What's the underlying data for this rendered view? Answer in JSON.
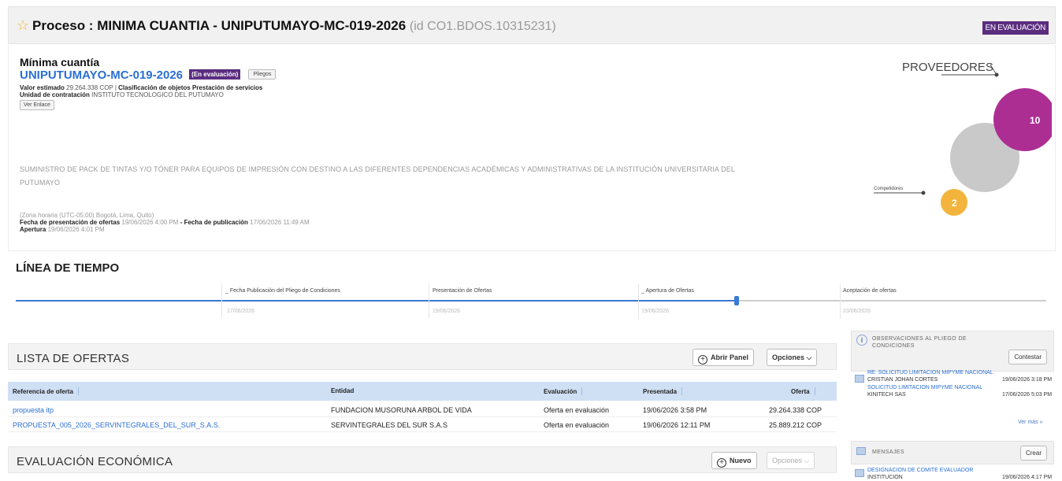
{
  "header": {
    "title": "Proceso : MINIMA CUANTIA  - UNIPUTUMAYO-MC-019-2026",
    "process_id": "(id CO1.BDOS.10315231)",
    "status_badge": "EN EVALUACIÓN"
  },
  "summary": {
    "modality": "Mínima cuantía",
    "code": "UNIPUTUMAYO-MC-019-2026",
    "status_tag": "(En evaluación)",
    "pliegos_button": "Pliegos",
    "valor_label": "Valor estimado",
    "valor_value": "29.264.338 COP",
    "sep": "|",
    "clasificacion_label": "Clasificación de objetos",
    "clasificacion_value": "Prestación de servicios",
    "unidad_label": "Unidad de contratación",
    "unidad_value": "INSTITUTO TECNOLOGICO DEL PUTUMAYO",
    "ver_enlace": "Ver Enlace",
    "description": "SUMINISTRO DE PACK DE TINTAS Y/O TÓNER PARA EQUIPOS DE IMPRESIÓN CON DESTINO A LAS DIFERENTES DEPENDENCIAS ACADÉMICAS Y ADMINISTRATIVAS DE LA INSTITUCIÓN UNIVERSITARIA DEL PUTUMAYO",
    "timezone": "(Zona horaria (UTC-05:00) Bogotá, Lima, Quito)",
    "fecha_presentacion_label": "Fecha de presentación de ofertas",
    "fecha_presentacion_value": "19/06/2026 4:00 PM",
    "dash": "-",
    "fecha_publicacion_label": "Fecha de publicación",
    "fecha_publicacion_value": "17/06/2026 11:49 AM",
    "apertura_label": "Apertura",
    "apertura_value": "19/06/2026 4:01 PM"
  },
  "providers": {
    "title": "PROVEEDORES",
    "big_count": "10",
    "competitors_label": "Competidores",
    "small_count": "2"
  },
  "timeline": {
    "title": "LÍNEA DE TIEMPO",
    "progress": 0.7,
    "stages": [
      {
        "label": "Fecha Publicación del Pliego de Condiciones",
        "date": "17/06/2026"
      },
      {
        "label": "Presentación de Ofertas",
        "date": "19/06/2026"
      },
      {
        "label": "Apertura de Ofertas",
        "date": "19/06/2026"
      },
      {
        "label": "Aceptación de ofertas",
        "date": "23/06/2026"
      }
    ]
  },
  "offers": {
    "title": "LISTA DE OFERTAS",
    "open_panel": "Abrir Panel",
    "options": "Opciones",
    "columns": [
      "Referencia de oferta",
      "Entidad",
      "Evaluación",
      "Presentada",
      "Oferta"
    ],
    "rows": [
      [
        "propuesta itp",
        "FUNDACION MUSORUNA ARBOL DE VIDA",
        "Oferta en evaluación",
        "19/06/2026 3:58 PM",
        "29.264.338 COP"
      ],
      [
        "PROPUESTA_005_2026_SERVINTEGRALES_DEL_SUR_S.A.S.",
        "SERVINTEGRALES DEL SUR S.A.S",
        "Oferta en evaluación",
        "19/06/2026 12:11 PM",
        "25.889.212 COP"
      ]
    ]
  },
  "economic": {
    "title": "EVALUACIÓN ECONÓMICA",
    "new_button": "Nuevo",
    "options": "Opciones"
  },
  "observations": {
    "title_line1": "OBSERVACIONES AL PLIEGO DE",
    "title_line2": "CONDICIONES",
    "reply_button": "Contestar",
    "items": [
      {
        "subject": "RE: SOLICITUD LIMITACION MIPYME NACIONAL",
        "author": "CRISTIAN JOHAN CORTES",
        "date": "19/06/2026 3:18 PM"
      },
      {
        "subject": "SOLICITUD LIMITACION MIPYME NACIONAL",
        "author": "KINITECH SAS",
        "date": "17/06/2026 5:03 PM"
      }
    ],
    "see_more": "Ver más »"
  },
  "messages": {
    "title": "MENSAJES",
    "create_button": "Crear",
    "items": [
      {
        "subject": "DESIGNACION DE COMITE EVALUADOR",
        "author": "INSTITUCION",
        "date": "19/06/2026 4:17 PM"
      }
    ]
  }
}
